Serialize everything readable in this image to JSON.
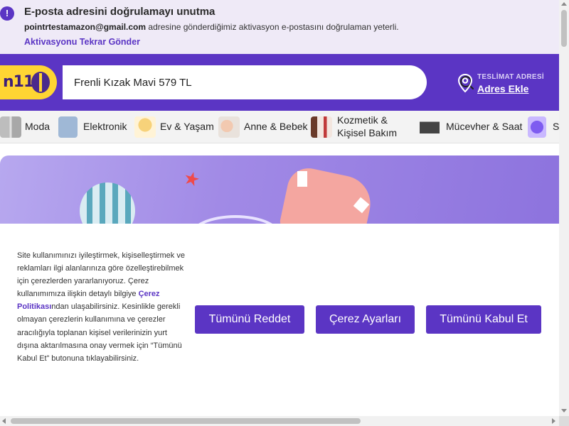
{
  "banner": {
    "icon": "exclamation-icon",
    "title": "E-posta adresini doğrulamayı unutma",
    "email": "pointrtestamazon@gmail.com",
    "message": " adresine gönderdiğimiz aktivasyon e-postasını doğrulaman yeterli.",
    "resend_link": "Aktivasyonu Tekrar Gönder"
  },
  "header": {
    "logo_text": "n11",
    "search_value": "Frenli Kızak Mavi 579 TL",
    "search_icon": "magnifier-icon",
    "address_icon": "location-pin-icon",
    "address_label": "TESLİMAT ADRESİ",
    "address_link": "Adres Ekle"
  },
  "categories": [
    {
      "label": "Moda"
    },
    {
      "label": "Elektronik"
    },
    {
      "label": "Ev & Yaşam"
    },
    {
      "label": "Anne & Bebek"
    },
    {
      "label_line1": "Kozmetik &",
      "label_line2": "Kişisel Bakım"
    },
    {
      "label": "Mücevher & Saat"
    },
    {
      "label": "S"
    }
  ],
  "cookie": {
    "text_before": "Site kullanımınızı iyileştirmek, kişiselleştirmek ve reklamları ilgi alanlarınıza göre özelleştirebilmek için çerezlerden yararlanıyoruz. Çerez kullanımımıza ilişkin detaylı bilgiye ",
    "policy_link": "Çerez Politikası",
    "text_after": "ndan ulaşabilirsiniz. Kesinlikle gerekli olmayan çerezlerin kullanımına ve çerezler aracılığıyla toplanan kişisel verilerinizin yurt dışına aktarılmasına onay vermek için “Tümünü Kabul Et” butonuna tıklayabilirsiniz.",
    "reject_button": "Tümünü Reddet",
    "settings_button": "Çerez Ayarları",
    "accept_button": "Tümünü Kabul Et"
  },
  "colors": {
    "brand_purple": "#5b35c4",
    "logo_yellow": "#ffd533",
    "banner_bg": "#efeaf7"
  }
}
